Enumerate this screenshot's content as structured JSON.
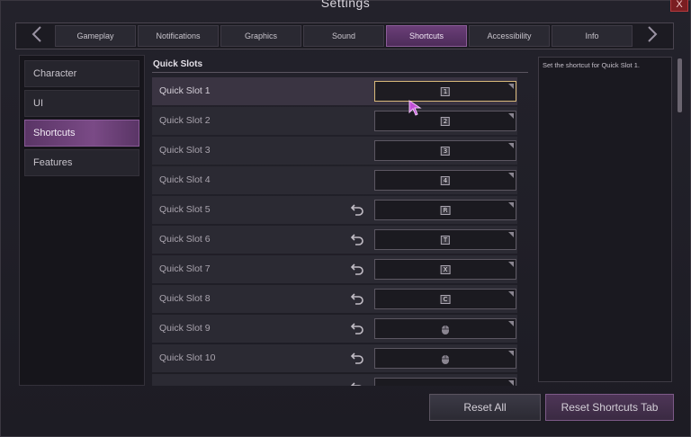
{
  "window": {
    "title": "Settings",
    "close_label": "X"
  },
  "tabs": [
    {
      "label": "Gameplay",
      "active": false
    },
    {
      "label": "Notifications",
      "active": false
    },
    {
      "label": "Graphics",
      "active": false
    },
    {
      "label": "Sound",
      "active": false
    },
    {
      "label": "Shortcuts",
      "active": true
    },
    {
      "label": "Accessibility",
      "active": false
    },
    {
      "label": "Info",
      "active": false
    }
  ],
  "sidebar": {
    "items": [
      {
        "label": "Character",
        "active": false
      },
      {
        "label": "UI",
        "active": false
      },
      {
        "label": "Shortcuts",
        "active": true
      },
      {
        "label": "Features",
        "active": false
      }
    ]
  },
  "main": {
    "section_title": "Quick Slots",
    "rows": [
      {
        "label": "Quick Slot 1",
        "key": "1",
        "key_type": "key",
        "resettable": false,
        "active": true
      },
      {
        "label": "Quick Slot 2",
        "key": "2",
        "key_type": "key",
        "resettable": false
      },
      {
        "label": "Quick Slot 3",
        "key": "3",
        "key_type": "key",
        "resettable": false
      },
      {
        "label": "Quick Slot 4",
        "key": "4",
        "key_type": "key",
        "resettable": false
      },
      {
        "label": "Quick Slot 5",
        "key": "R",
        "key_type": "key",
        "resettable": true
      },
      {
        "label": "Quick Slot 6",
        "key": "T",
        "key_type": "key",
        "resettable": true
      },
      {
        "label": "Quick Slot 7",
        "key": "X",
        "key_type": "key",
        "resettable": true
      },
      {
        "label": "Quick Slot 8",
        "key": "C",
        "key_type": "key",
        "resettable": true
      },
      {
        "label": "Quick Slot 9",
        "key": "",
        "key_type": "mouse-icon",
        "resettable": true
      },
      {
        "label": "Quick Slot 10",
        "key": "",
        "key_type": "mouse-icon",
        "resettable": true
      },
      {
        "label": "",
        "key": "",
        "key_type": "partial",
        "resettable": true
      }
    ]
  },
  "description": {
    "text": "Set the shortcut for Quick Slot 1."
  },
  "footer": {
    "reset_all_label": "Reset All",
    "reset_tab_label": "Reset Shortcuts Tab"
  },
  "colors": {
    "accent_purple": "#6a3e78",
    "active_border_gold": "#d8b97a",
    "background": "#1d1c24"
  }
}
